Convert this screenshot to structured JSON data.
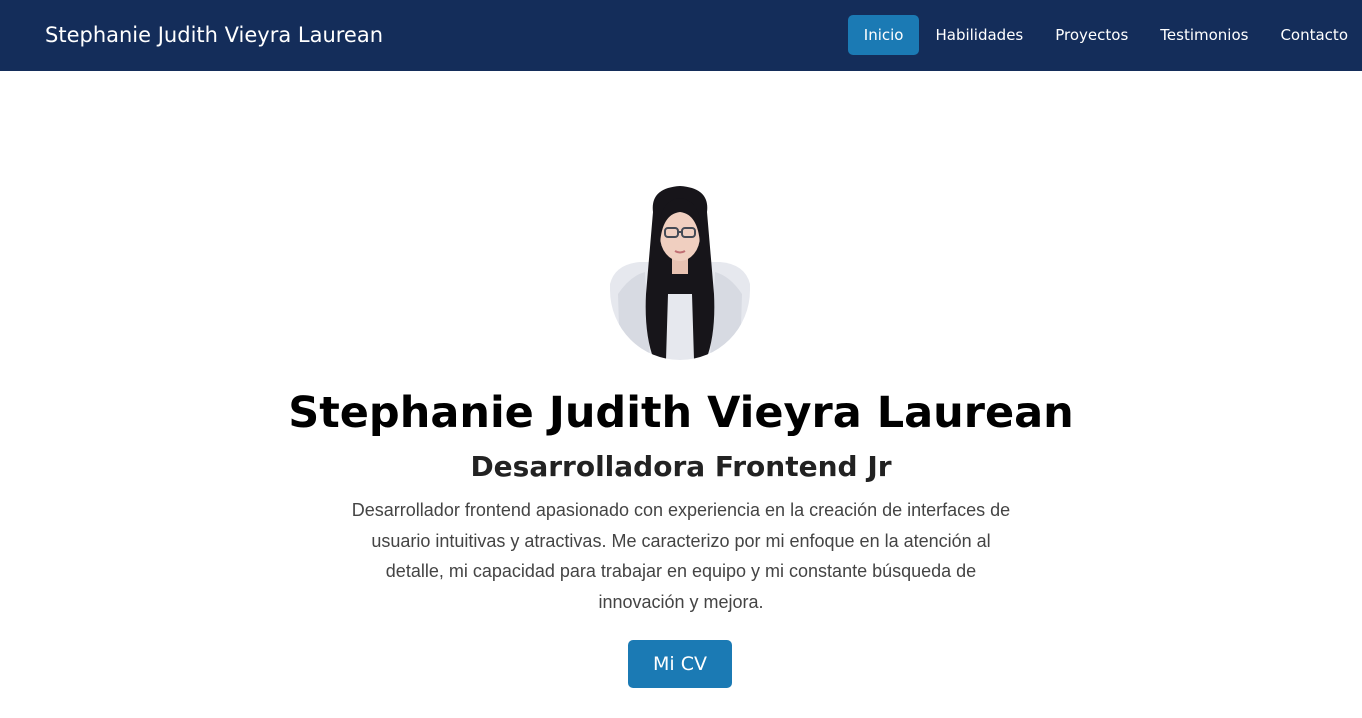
{
  "navbar": {
    "brand": "Stephanie Judith Vieyra Laurean",
    "links": [
      {
        "label": "Inicio",
        "active": true
      },
      {
        "label": "Habilidades",
        "active": false
      },
      {
        "label": "Proyectos",
        "active": false
      },
      {
        "label": "Testimonios",
        "active": false
      },
      {
        "label": "Contacto",
        "active": false
      }
    ]
  },
  "hero": {
    "name": "Stephanie Judith Vieyra Laurean",
    "title": "Desarrolladora Frontend Jr",
    "description": "Desarrollador frontend apasionado con experiencia en la creación de interfaces de usuario intuitivas y atractivas. Me caracterizo por mi enfoque en la atención al detalle, mi capacidad para trabajar en equipo y mi constante búsqueda de innovación y mejora.",
    "cv_button": "Mi CV"
  },
  "colors": {
    "navbar_bg": "#142d5a",
    "accent": "#1b7ab4",
    "text_dark": "#000000",
    "text_body": "#444444"
  }
}
